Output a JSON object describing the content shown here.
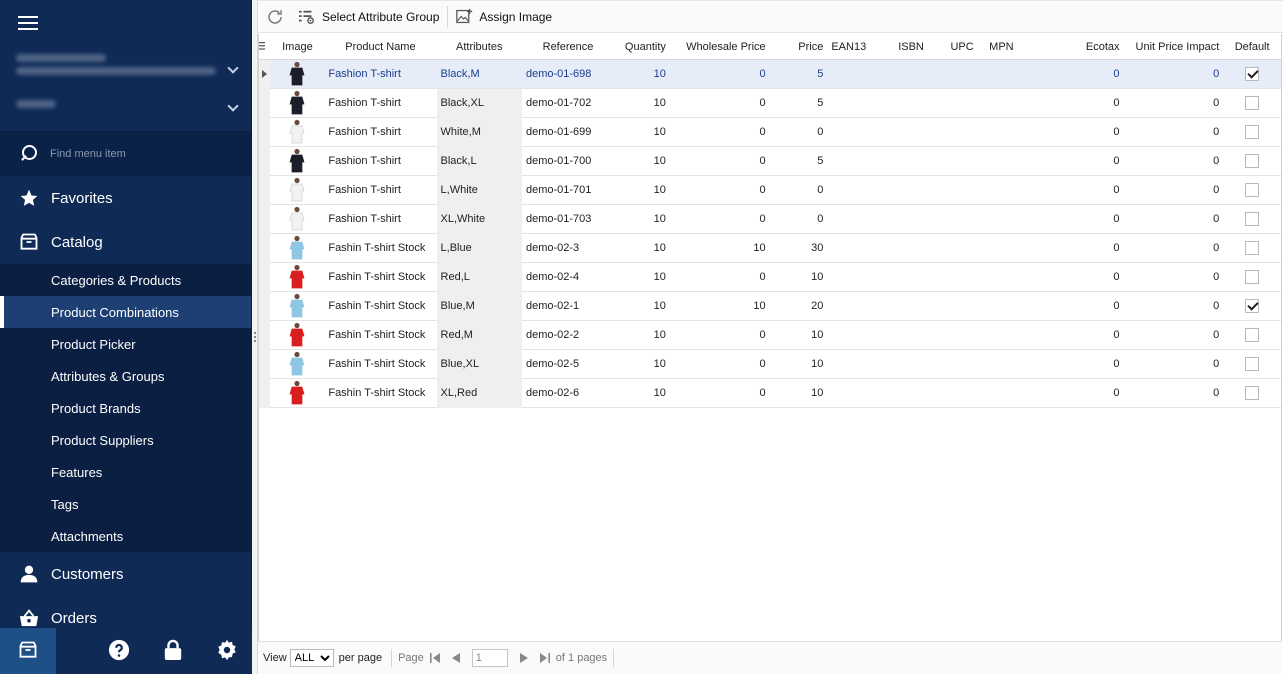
{
  "sidebar": {
    "search_placeholder": "Find menu item",
    "groups_top": [
      {
        "label": "Favorites"
      },
      {
        "label": "Catalog"
      }
    ],
    "catalog_items": [
      {
        "label": "Categories & Products",
        "active": false
      },
      {
        "label": "Product Combinations",
        "active": true
      },
      {
        "label": "Product Picker",
        "active": false
      },
      {
        "label": "Attributes & Groups",
        "active": false
      },
      {
        "label": "Product Brands",
        "active": false
      },
      {
        "label": "Product Suppliers",
        "active": false
      },
      {
        "label": "Features",
        "active": false
      },
      {
        "label": "Tags",
        "active": false
      },
      {
        "label": "Attachments",
        "active": false
      }
    ],
    "groups_bottom": [
      {
        "label": "Customers"
      },
      {
        "label": "Orders"
      }
    ]
  },
  "toolbar": {
    "select_attribute_group": "Select Attribute Group",
    "assign_image": "Assign Image"
  },
  "grid": {
    "columns": {
      "image": "Image",
      "product_name": "Product Name",
      "attributes": "Attributes",
      "reference": "Reference",
      "quantity": "Quantity",
      "wholesale_price": "Wholesale Price",
      "price": "Price",
      "ean13": "EAN13",
      "isbn": "ISBN",
      "upc": "UPC",
      "mpn": "MPN",
      "ecotax": "Ecotax",
      "unit_price_impact": "Unit Price Impact",
      "default": "Default"
    },
    "rows": [
      {
        "thumb": "black",
        "name": "Fashion T-shirt",
        "attrs": "Black,M",
        "ref": "demo-01-698",
        "qty": "10",
        "wprice": "0",
        "price": "5",
        "ecotax": "0",
        "upi": "0",
        "default": true,
        "selected": true
      },
      {
        "thumb": "black",
        "name": "Fashion T-shirt",
        "attrs": "Black,XL",
        "ref": "demo-01-702",
        "qty": "10",
        "wprice": "0",
        "price": "5",
        "ecotax": "0",
        "upi": "0",
        "default": false
      },
      {
        "thumb": "white",
        "name": "Fashion T-shirt",
        "attrs": "White,M",
        "ref": "demo-01-699",
        "qty": "10",
        "wprice": "0",
        "price": "0",
        "ecotax": "0",
        "upi": "0",
        "default": false
      },
      {
        "thumb": "black",
        "name": "Fashion T-shirt",
        "attrs": "Black,L",
        "ref": "demo-01-700",
        "qty": "10",
        "wprice": "0",
        "price": "5",
        "ecotax": "0",
        "upi": "0",
        "default": false
      },
      {
        "thumb": "white",
        "name": "Fashion T-shirt",
        "attrs": "L,White",
        "ref": "demo-01-701",
        "qty": "10",
        "wprice": "0",
        "price": "0",
        "ecotax": "0",
        "upi": "0",
        "default": false
      },
      {
        "thumb": "white",
        "name": "Fashion T-shirt",
        "attrs": "XL,White",
        "ref": "demo-01-703",
        "qty": "10",
        "wprice": "0",
        "price": "0",
        "ecotax": "0",
        "upi": "0",
        "default": false
      },
      {
        "thumb": "blue",
        "name": "Fashin T-shirt Stock",
        "attrs": "L,Blue",
        "ref": "demo-02-3",
        "qty": "10",
        "wprice": "10",
        "price": "30",
        "ecotax": "0",
        "upi": "0",
        "default": false
      },
      {
        "thumb": "red",
        "name": "Fashin T-shirt Stock",
        "attrs": "Red,L",
        "ref": "demo-02-4",
        "qty": "10",
        "wprice": "0",
        "price": "10",
        "ecotax": "0",
        "upi": "0",
        "default": false
      },
      {
        "thumb": "blue",
        "name": "Fashin T-shirt Stock",
        "attrs": "Blue,M",
        "ref": "demo-02-1",
        "qty": "10",
        "wprice": "10",
        "price": "20",
        "ecotax": "0",
        "upi": "0",
        "default": true
      },
      {
        "thumb": "red",
        "name": "Fashin T-shirt Stock",
        "attrs": "Red,M",
        "ref": "demo-02-2",
        "qty": "10",
        "wprice": "0",
        "price": "10",
        "ecotax": "0",
        "upi": "0",
        "default": false
      },
      {
        "thumb": "blue",
        "name": "Fashin T-shirt Stock",
        "attrs": "Blue,XL",
        "ref": "demo-02-5",
        "qty": "10",
        "wprice": "0",
        "price": "10",
        "ecotax": "0",
        "upi": "0",
        "default": false
      },
      {
        "thumb": "red",
        "name": "Fashin T-shirt Stock",
        "attrs": "XL,Red",
        "ref": "demo-02-6",
        "qty": "10",
        "wprice": "0",
        "price": "10",
        "ecotax": "0",
        "upi": "0",
        "default": false
      }
    ]
  },
  "pager": {
    "view_label": "View",
    "per_page_value": "ALL",
    "per_page_label": "per page",
    "page_label": "Page",
    "page_value": "1",
    "of_pages": "of 1 pages"
  },
  "colors": {
    "sidebar_bg": "#0f2a55",
    "sidebar_sub_bg": "#0a1f42",
    "active_item_bg": "#1e3f73",
    "selected_row_bg": "#e6ecf8",
    "selected_row_text": "#1b3e8f",
    "thumb_black": "#1c1f2a",
    "thumb_white": "#f2f2f2",
    "thumb_blue": "#8fc6e3",
    "thumb_red": "#d81e1e"
  }
}
